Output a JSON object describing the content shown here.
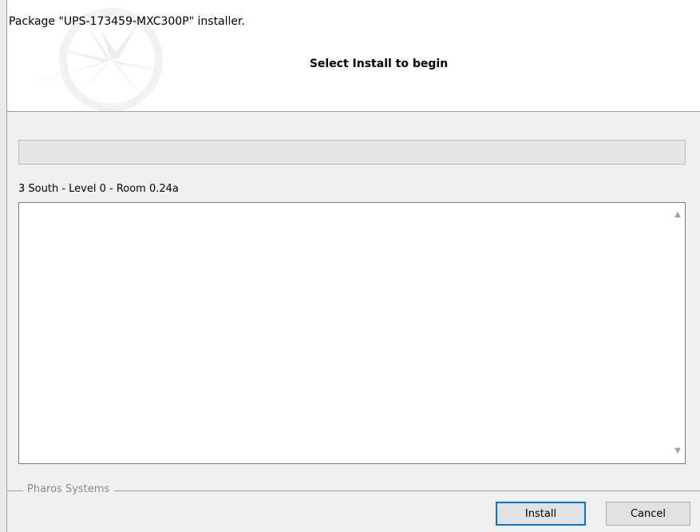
{
  "header": {
    "title": "Package \"UPS-173459-MXC300P\" installer.",
    "subtitle": "Select Install to begin"
  },
  "progress": {
    "fraction": 0
  },
  "location_label": "3 South - Level 0 - Room 0.24a",
  "log": {
    "content": "",
    "scroll_up_icon": "chevron-up-icon",
    "scroll_down_icon": "chevron-down-icon"
  },
  "footer": {
    "group_label": "Pharos Systems",
    "install_label": "Install",
    "cancel_label": "Cancel"
  },
  "colors": {
    "accent": "#0078d7",
    "background": "#f0f0f0"
  }
}
